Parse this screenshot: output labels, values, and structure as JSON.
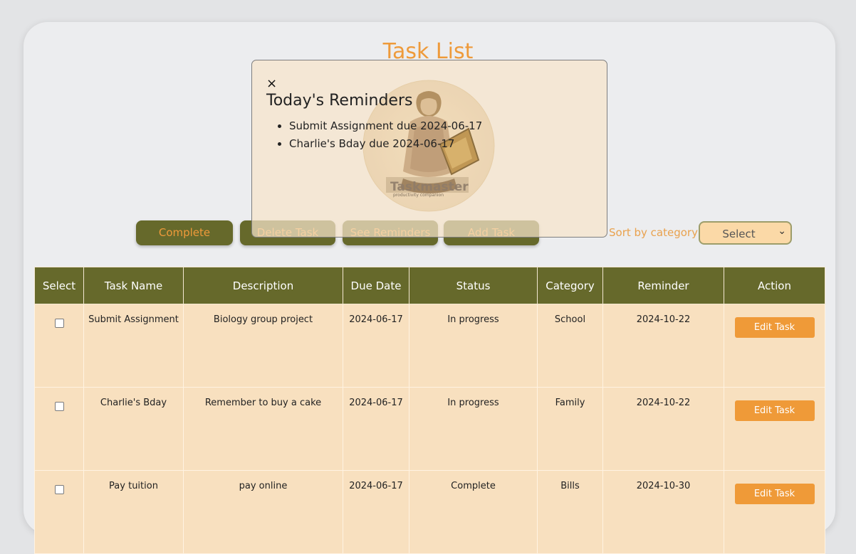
{
  "page": {
    "title": "Task List"
  },
  "toolbar": {
    "complete_label": "Complete",
    "delete_label": "Delete Task",
    "reminders_label": "See Reminders",
    "add_label": "Add Task",
    "sort_label": "Sort by category",
    "sort_selected": "Select"
  },
  "table": {
    "headers": [
      "Select",
      "Task Name",
      "Description",
      "Due Date",
      "Status",
      "Category",
      "Reminder",
      "Action"
    ],
    "rows": [
      {
        "name": "Submit Assignment",
        "description": "Biology group project",
        "due": "2024-06-17",
        "status": "In progress",
        "category": "School",
        "reminder": "2024-10-22",
        "action": "Edit Task"
      },
      {
        "name": "Charlie's Bday",
        "description": "Remember to buy a cake",
        "due": "2024-06-17",
        "status": "In progress",
        "category": "Family",
        "reminder": "2024-10-22",
        "action": "Edit Task"
      },
      {
        "name": "Pay tuition",
        "description": "pay online",
        "due": "2024-06-17",
        "status": "Complete",
        "category": "Bills",
        "reminder": "2024-10-30",
        "action": "Edit Task"
      }
    ]
  },
  "modal": {
    "close_glyph": "×",
    "title": "Today's Reminders",
    "items": [
      "Submit Assignment due 2024-06-17",
      "Charlie's Bday due 2024-06-17"
    ],
    "logo": {
      "text": "Taskmaster",
      "tagline": "productivity companion"
    }
  },
  "colors": {
    "accent": "#ee9a3a",
    "olive": "#66692b",
    "row_bg": "#f8e0bf"
  }
}
